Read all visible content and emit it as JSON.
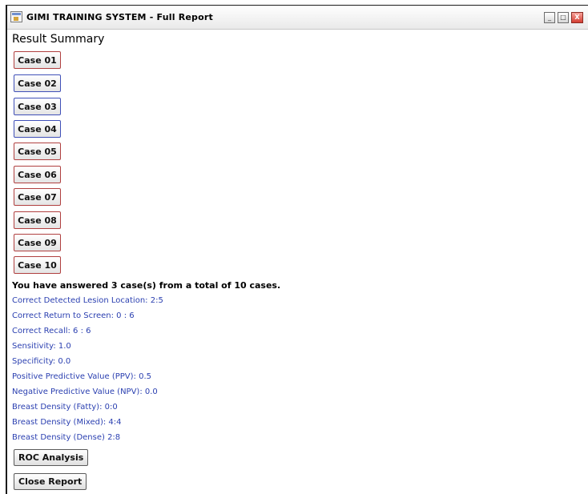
{
  "window": {
    "title": "GIMI TRAINING SYSTEM - Full Report",
    "minimize": "_",
    "maximize": "□",
    "close": "X"
  },
  "report": {
    "summary_title": "Result Summary",
    "cases": [
      {
        "label": "Case 01",
        "border_color": "#b04040"
      },
      {
        "label": "Case 02",
        "border_color": "#4050b8"
      },
      {
        "label": "Case 03",
        "border_color": "#4050b8"
      },
      {
        "label": "Case 04",
        "border_color": "#4050b8"
      },
      {
        "label": "Case 05",
        "border_color": "#b04040"
      },
      {
        "label": "Case 06",
        "border_color": "#b04040"
      },
      {
        "label": "Case 07",
        "border_color": "#b04040"
      },
      {
        "label": "Case 08",
        "border_color": "#b04040"
      },
      {
        "label": "Case 09",
        "border_color": "#b04040"
      },
      {
        "label": "Case 10",
        "border_color": "#b04040"
      }
    ],
    "answered_text": "You have answered 3 case(s) from a total of 10 cases.",
    "metrics": [
      "Correct Detected Lesion Location: 2:5",
      "Correct Return to Screen: 0 : 6",
      "Correct Recall:  6 : 6",
      "Sensitivity: 1.0",
      "Specificity: 0.0",
      "Positive Predictive Value (PPV): 0.5",
      "Negative Predictive Value (NPV): 0.0",
      "Breast Density (Fatty): 0:0",
      "Breast Density (Mixed): 4:4",
      "Breast Density (Dense) 2:8"
    ],
    "roc_button": "ROC Analysis",
    "close_button": "Close Report"
  },
  "colors": {
    "metric_text": "#2a3fb0",
    "case_border_red": "#b04040",
    "case_border_blue": "#4050b8"
  }
}
